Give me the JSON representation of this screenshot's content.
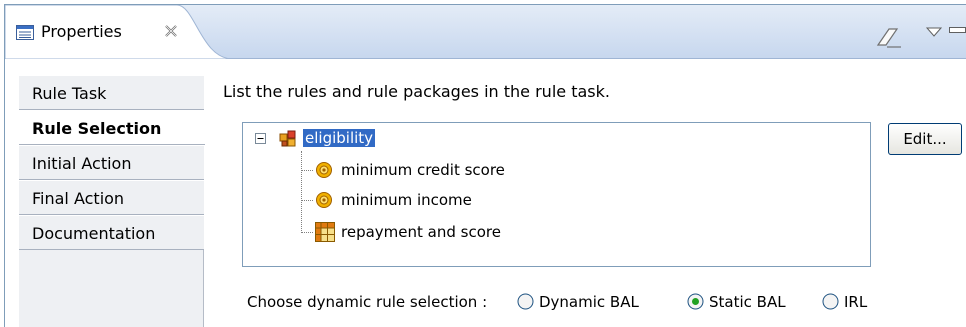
{
  "view": {
    "tab_title": "Properties",
    "tab_icon": "properties-list-icon",
    "close_icon": "close-x-icon",
    "toolbar_icons": [
      "eraser-icon",
      "view-menu-triangle-icon",
      "minimize-icon"
    ]
  },
  "sections": [
    {
      "label": "Rule Task",
      "selected": false
    },
    {
      "label": "Rule Selection",
      "selected": true
    },
    {
      "label": "Initial Action",
      "selected": false
    },
    {
      "label": "Final Action",
      "selected": false
    },
    {
      "label": "Documentation",
      "selected": false
    }
  ],
  "main": {
    "description": "List the rules and rule packages in the rule task.",
    "edit_label": "Edit...",
    "tree": {
      "root": {
        "label": "eligibility",
        "icon": "rule-package-icon",
        "expanded": true,
        "selected": true
      },
      "children": [
        {
          "label": "minimum credit score",
          "icon": "action-rule-icon"
        },
        {
          "label": "minimum income",
          "icon": "action-rule-icon"
        },
        {
          "label": "repayment and score",
          "icon": "decision-table-icon"
        }
      ]
    },
    "dynamic_selection": {
      "label": "Choose dynamic rule selection :",
      "options": [
        "Dynamic BAL",
        "Static BAL",
        "IRL"
      ],
      "selected": "Static BAL"
    }
  },
  "colors": {
    "selection": "#316ac5",
    "border": "#7f9db9",
    "tab_bar": "#c7d7ee"
  }
}
